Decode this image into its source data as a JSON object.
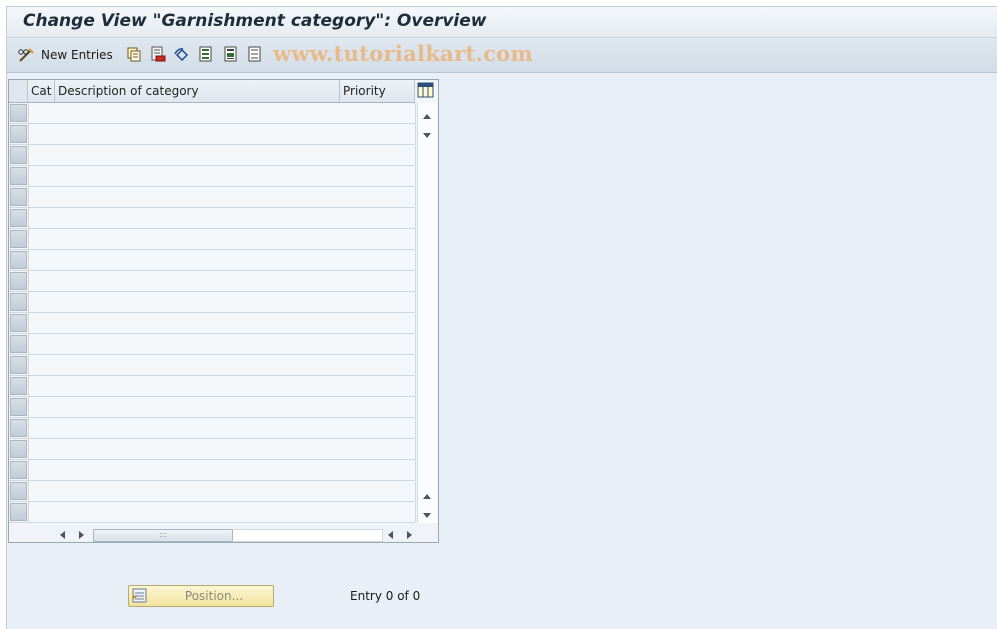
{
  "window": {
    "title": "Change View \"Garnishment category\": Overview"
  },
  "toolbar": {
    "new_entries_label": "New Entries",
    "watermark": "www.tutorialkart.com",
    "icons": [
      "pencil-glasses-icon",
      "copy-icon",
      "delete-icon",
      "undo-icon",
      "select-all-icon",
      "select-block-icon",
      "deselect-all-icon"
    ]
  },
  "table": {
    "headers": {
      "cat": "Cat",
      "description": "Description of category",
      "priority": "Priority"
    },
    "row_count": 20,
    "config_icon": "table-settings-icon"
  },
  "footer": {
    "position_label": "Position...",
    "entry_text": "Entry 0 of 0"
  },
  "colors": {
    "background": "#e9eff6",
    "button_yellow": "#f2e49d",
    "watermark": "#e8b98a"
  }
}
